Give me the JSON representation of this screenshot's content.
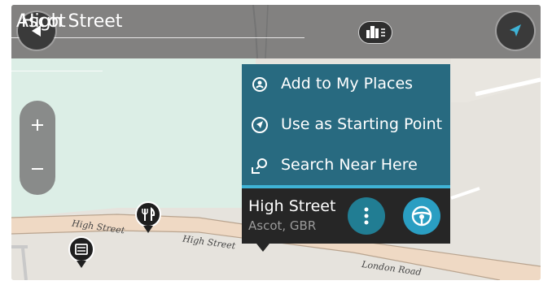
{
  "search": {
    "street_value": "High Street",
    "city_value": "Ascot"
  },
  "popup_menu": {
    "items": [
      {
        "label": "Add to My Places",
        "icon": "add-place-icon"
      },
      {
        "label": "Use as Starting Point",
        "icon": "starting-point-icon"
      },
      {
        "label": "Search Near Here",
        "icon": "search-near-icon"
      }
    ]
  },
  "location_card": {
    "title": "High Street",
    "subtitle": "Ascot, GBR"
  },
  "map": {
    "road_labels": [
      "High Street",
      "High Street",
      "London Road"
    ],
    "poi_pins": [
      {
        "icon": "restaurant-icon"
      },
      {
        "icon": "cash-machine-icon"
      }
    ]
  },
  "colors": {
    "popup_bg": "#286a80",
    "card_bg": "#262626",
    "drive_button": "#2a9ec2",
    "more_button": "#217d93",
    "map_land": "#e6e3dd",
    "map_green": "#dceee6",
    "map_road": "#efd9c4"
  }
}
